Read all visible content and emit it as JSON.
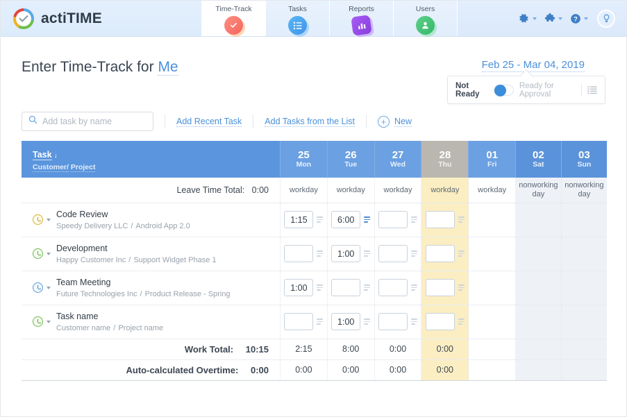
{
  "brand": {
    "name": "actiTIME",
    "logo_icon": "acti-time-logo"
  },
  "nav": {
    "tabs": [
      {
        "label": "Time-Track",
        "icon": "check-circle-icon",
        "active": true
      },
      {
        "label": "Tasks",
        "icon": "list-icon",
        "active": false
      },
      {
        "label": "Reports",
        "icon": "bar-chart-icon",
        "active": false
      },
      {
        "label": "Users",
        "icon": "user-icon",
        "active": false
      }
    ],
    "right_icons": [
      {
        "name": "gear-icon",
        "has_caret": true
      },
      {
        "name": "puzzle-icon",
        "has_caret": true
      },
      {
        "name": "help-icon",
        "has_caret": true
      },
      {
        "name": "lightbulb-icon",
        "has_caret": false
      }
    ]
  },
  "page": {
    "title_prefix": "Enter Time-Track for",
    "title_user": "Me",
    "date_range": "Feb 25 - Mar 04, 2019"
  },
  "approval": {
    "not_ready_label": "Not Ready",
    "ready_label": "Ready for Approval",
    "toggle_state": "off",
    "list_icon": "list-lines-icon"
  },
  "toolbar": {
    "search_placeholder": "Add task by name",
    "search_value": "",
    "search_icon": "search-icon",
    "add_recent_task": "Add Recent Task",
    "add_tasks_from_list": "Add Tasks from the List",
    "new_label": "New",
    "plus_icon": "plus-circle-icon"
  },
  "table": {
    "task_header": {
      "title": "Task",
      "sort_arrow": "↓",
      "customer": "Customer",
      "separator": "/",
      "project": "Project"
    },
    "days": [
      {
        "num": "25",
        "weekday": "Mon",
        "type": "workday",
        "has_caret": true,
        "weekend": false,
        "today": false
      },
      {
        "num": "26",
        "weekday": "Tue",
        "type": "workday",
        "has_caret": true,
        "weekend": false,
        "today": false
      },
      {
        "num": "27",
        "weekday": "Wed",
        "type": "workday",
        "has_caret": true,
        "weekend": false,
        "today": false
      },
      {
        "num": "28",
        "weekday": "Thu",
        "type": "workday",
        "has_caret": true,
        "weekend": false,
        "today": true
      },
      {
        "num": "01",
        "weekday": "Fri",
        "type": "workday",
        "has_caret": false,
        "weekend": false,
        "today": false
      },
      {
        "num": "02",
        "weekday": "Sat",
        "type": "nonworking day",
        "has_caret": false,
        "weekend": true,
        "today": false
      },
      {
        "num": "03",
        "weekday": "Sun",
        "type": "nonworking day",
        "has_caret": false,
        "weekend": true,
        "today": false
      }
    ],
    "leave_time": {
      "label": "Leave Time Total:",
      "value": "0:00"
    },
    "rows": [
      {
        "clock_color": "yellow",
        "name": "Code Review",
        "customer": "Speedy Delivery LLC",
        "project": "Android App 2.0",
        "cells": [
          {
            "value": "1:15",
            "note": false
          },
          {
            "value": "6:00",
            "note": true
          },
          {
            "value": "",
            "note": false
          },
          {
            "value": "",
            "note": false
          },
          {
            "value": null,
            "note": false
          },
          {
            "value": null,
            "note": false
          },
          {
            "value": null,
            "note": false
          }
        ]
      },
      {
        "clock_color": "green",
        "name": "Development",
        "customer": "Happy Customer Inc",
        "project": "Support Widget Phase 1",
        "cells": [
          {
            "value": "",
            "note": false
          },
          {
            "value": "1:00",
            "note": false
          },
          {
            "value": "",
            "note": false
          },
          {
            "value": "",
            "note": false
          },
          {
            "value": null,
            "note": false
          },
          {
            "value": null,
            "note": false
          },
          {
            "value": null,
            "note": false
          }
        ]
      },
      {
        "clock_color": "blue",
        "name": "Team Meeting",
        "customer": "Future Technologies Inc",
        "project": "Product Release - Spring",
        "cells": [
          {
            "value": "1:00",
            "note": false
          },
          {
            "value": "",
            "note": false
          },
          {
            "value": "",
            "note": false
          },
          {
            "value": "",
            "note": false
          },
          {
            "value": null,
            "note": false
          },
          {
            "value": null,
            "note": false
          },
          {
            "value": null,
            "note": false
          }
        ]
      },
      {
        "clock_color": "green",
        "name": "Task name",
        "customer": "Customer name",
        "project": "Project name",
        "cells": [
          {
            "value": "",
            "note": false
          },
          {
            "value": "1:00",
            "note": false
          },
          {
            "value": "",
            "note": false
          },
          {
            "value": "",
            "note": false
          },
          {
            "value": null,
            "note": false
          },
          {
            "value": null,
            "note": false
          },
          {
            "value": null,
            "note": false
          }
        ]
      }
    ],
    "totals": [
      {
        "label": "Work Total:",
        "total": "10:15",
        "values": [
          "2:15",
          "8:00",
          "0:00",
          "0:00",
          "",
          "",
          ""
        ]
      },
      {
        "label": "Auto-calculated Overtime:",
        "total": "0:00",
        "values": [
          "0:00",
          "0:00",
          "0:00",
          "0:00",
          "",
          "",
          ""
        ]
      }
    ]
  },
  "colors": {
    "header_blue": "#6ba0e2",
    "task_header_blue": "#5b95dd",
    "today_yellow": "#fbeec2",
    "nonworking_gray": "#eef2f7",
    "link_blue": "#4a90d9"
  }
}
